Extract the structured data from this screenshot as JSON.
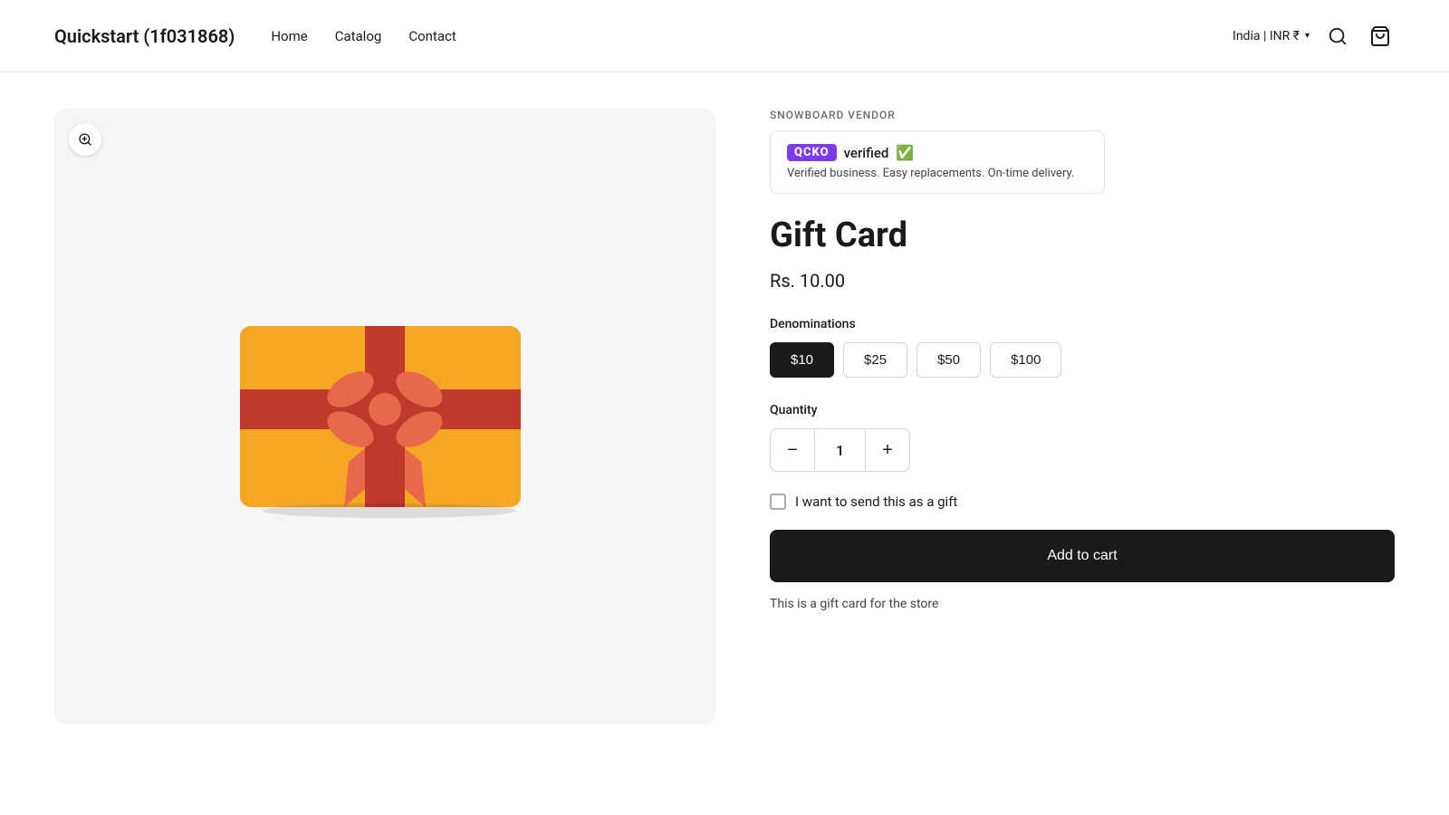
{
  "header": {
    "logo": "Quickstart (1f031868)",
    "nav": [
      {
        "label": "Home",
        "id": "home"
      },
      {
        "label": "Catalog",
        "id": "catalog"
      },
      {
        "label": "Contact",
        "id": "contact"
      }
    ],
    "locale": "India | INR ₹",
    "search_icon": "search",
    "cart_icon": "cart"
  },
  "product": {
    "vendor_label": "SNOWBOARD VENDOR",
    "vendor_logo_text": "QCKO",
    "vendor_verified": "verified",
    "vendor_tagline": "Verified business. Easy replacements. On-time delivery.",
    "title": "Gift Card",
    "price": "Rs. 10.00",
    "denominations_label": "Denominations",
    "denominations": [
      {
        "label": "$10",
        "value": 10,
        "active": true
      },
      {
        "label": "$25",
        "value": 25,
        "active": false
      },
      {
        "label": "$50",
        "value": 50,
        "active": false
      },
      {
        "label": "$100",
        "value": 100,
        "active": false
      }
    ],
    "quantity_label": "Quantity",
    "quantity": 1,
    "quantity_decrement": "−",
    "quantity_increment": "+",
    "gift_checkbox_label": "I want to send this as a gift",
    "add_to_cart_label": "Add to cart",
    "gift_card_note": "This is a gift card for the store"
  }
}
